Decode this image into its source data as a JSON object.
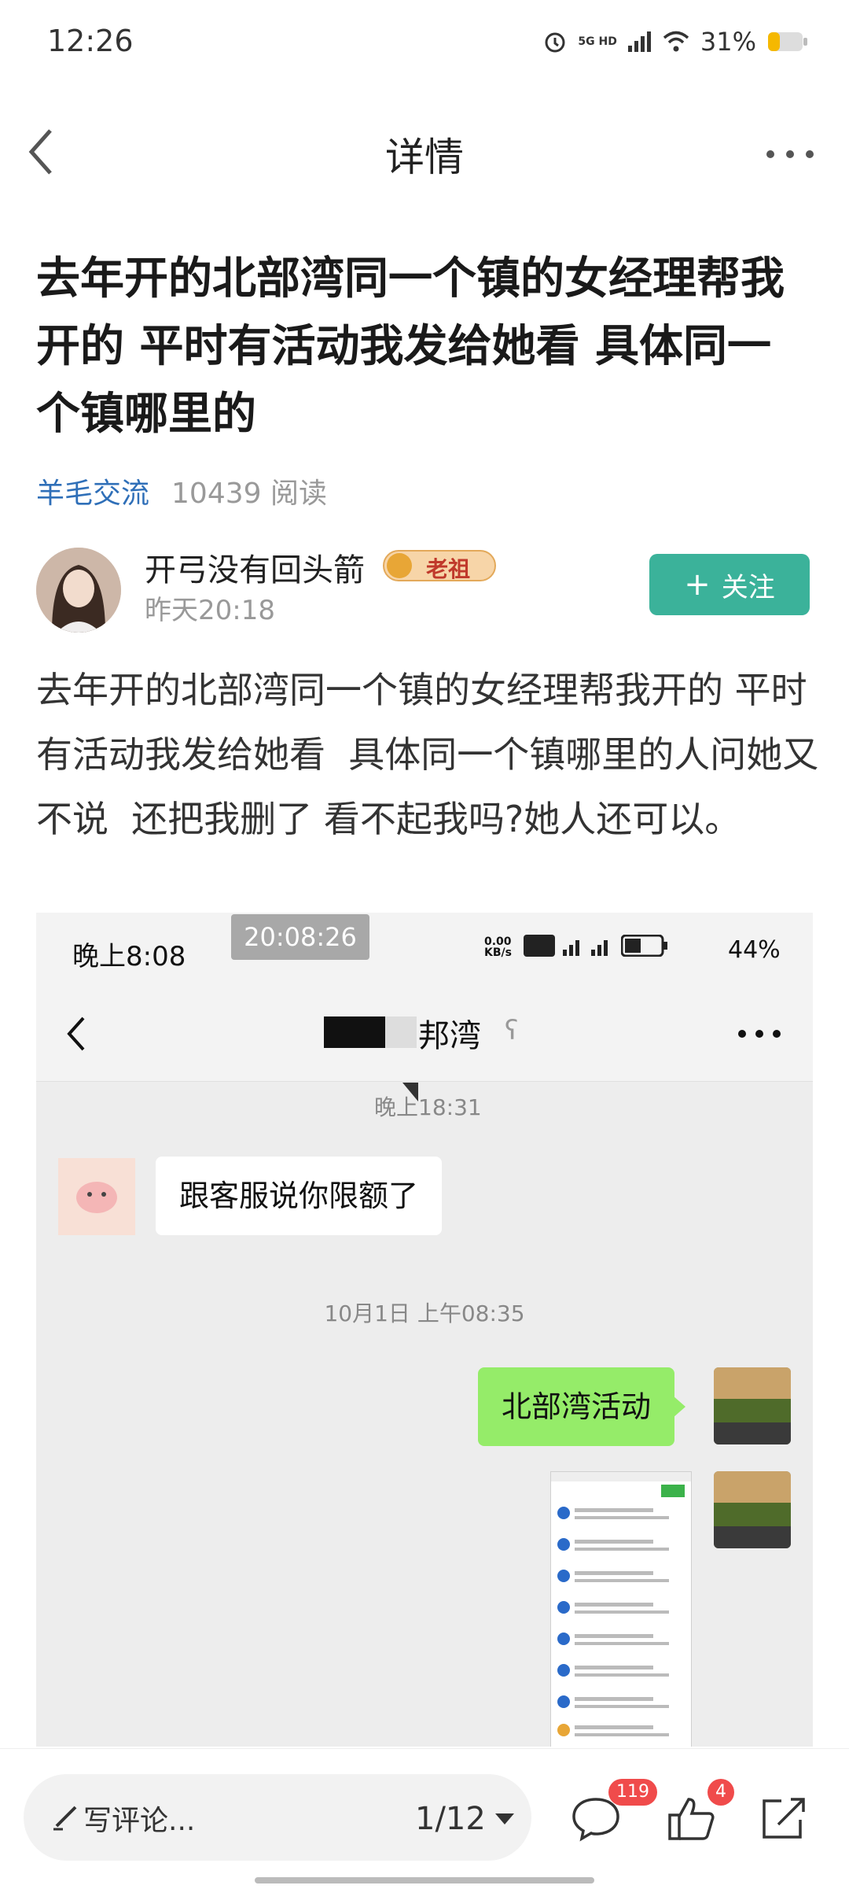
{
  "status_bar": {
    "time": "12:26",
    "network": "5G HD",
    "battery": "31%"
  },
  "nav": {
    "title": "详情"
  },
  "post": {
    "title": "去年开的北部湾同一个镇的女经理帮我开的 平时有活动我发给她看 具体同一个镇哪里的",
    "category": "羊毛交流",
    "read_count": "10439 阅读",
    "author": {
      "name": "开弓没有回头箭",
      "badge": "老祖",
      "time": "昨天20:18"
    },
    "follow_label": "关注",
    "body": "去年开的北部湾同一个镇的女经理帮我开的 平时有活动我发给她看  具体同一个镇哪里的人问她又不说  还把我删了 看不起我吗?她人还可以。"
  },
  "screenshot": {
    "status_time": "晚上8:08",
    "timestamp_overlay": "20:08:26",
    "speed": "0.00 KB/s",
    "battery": "44%",
    "chat_title": "邦湾",
    "date1": "晚上18:31",
    "msg1": "跟客服说你限额了",
    "date2": "10月1日 上午08:35",
    "msg2": "北部湾活动"
  },
  "bottom": {
    "comment_placeholder": "写评论...",
    "page_indicator": "1/12",
    "comment_count": "119",
    "like_count": "4"
  }
}
